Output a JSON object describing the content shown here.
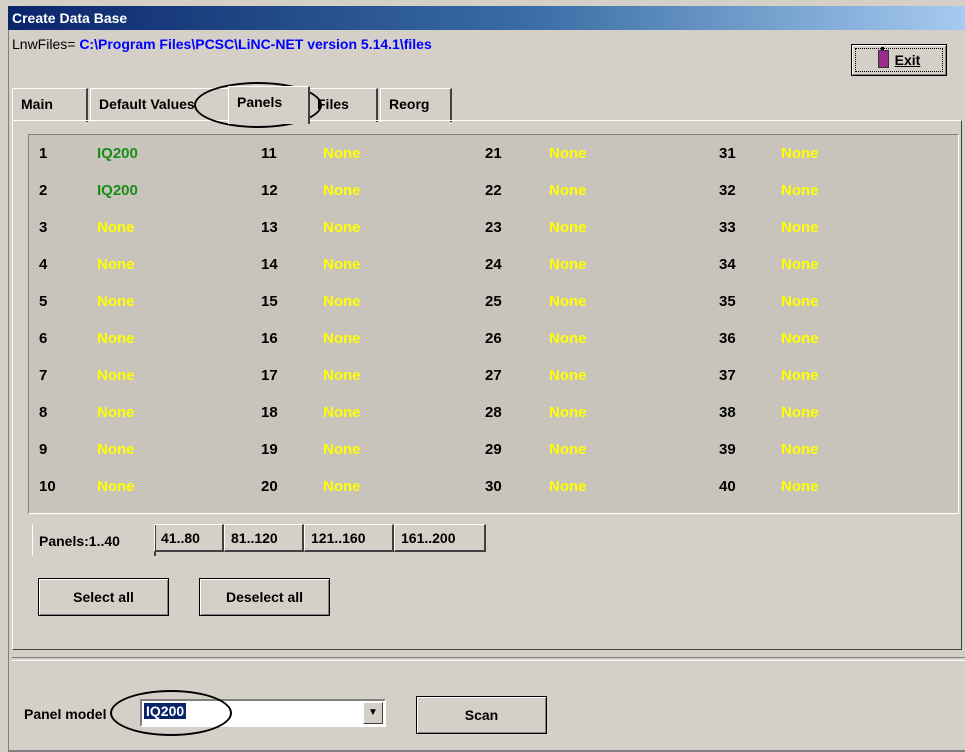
{
  "window": {
    "title": "Create Data Base"
  },
  "path": {
    "label": "LnwFiles=",
    "value": "C:\\Program Files\\PCSC\\LiNC-NET version 5.14.1\\files"
  },
  "exit_label": "Exit",
  "tabs": [
    "Main",
    "Default Values",
    "Panels",
    "Files",
    "Reorg"
  ],
  "active_tab": "Panels",
  "panels": {
    "col1": [
      {
        "num": "1",
        "name": "IQ200"
      },
      {
        "num": "2",
        "name": "IQ200"
      },
      {
        "num": "3",
        "name": "None"
      },
      {
        "num": "4",
        "name": "None"
      },
      {
        "num": "5",
        "name": "None"
      },
      {
        "num": "6",
        "name": "None"
      },
      {
        "num": "7",
        "name": "None"
      },
      {
        "num": "8",
        "name": "None"
      },
      {
        "num": "9",
        "name": "None"
      },
      {
        "num": "10",
        "name": "None"
      }
    ],
    "col2": [
      {
        "num": "11",
        "name": "None"
      },
      {
        "num": "12",
        "name": "None"
      },
      {
        "num": "13",
        "name": "None"
      },
      {
        "num": "14",
        "name": "None"
      },
      {
        "num": "15",
        "name": "None"
      },
      {
        "num": "16",
        "name": "None"
      },
      {
        "num": "17",
        "name": "None"
      },
      {
        "num": "18",
        "name": "None"
      },
      {
        "num": "19",
        "name": "None"
      },
      {
        "num": "20",
        "name": "None"
      }
    ],
    "col3": [
      {
        "num": "21",
        "name": "None"
      },
      {
        "num": "22",
        "name": "None"
      },
      {
        "num": "23",
        "name": "None"
      },
      {
        "num": "24",
        "name": "None"
      },
      {
        "num": "25",
        "name": "None"
      },
      {
        "num": "26",
        "name": "None"
      },
      {
        "num": "27",
        "name": "None"
      },
      {
        "num": "28",
        "name": "None"
      },
      {
        "num": "29",
        "name": "None"
      },
      {
        "num": "30",
        "name": "None"
      }
    ],
    "col4": [
      {
        "num": "31",
        "name": "None"
      },
      {
        "num": "32",
        "name": "None"
      },
      {
        "num": "33",
        "name": "None"
      },
      {
        "num": "34",
        "name": "None"
      },
      {
        "num": "35",
        "name": "None"
      },
      {
        "num": "36",
        "name": "None"
      },
      {
        "num": "37",
        "name": "None"
      },
      {
        "num": "38",
        "name": "None"
      },
      {
        "num": "39",
        "name": "None"
      },
      {
        "num": "40",
        "name": "None"
      }
    ]
  },
  "page_tabs": [
    "Panels:1..40",
    "41..80",
    "81..120",
    "121..160",
    "161..200"
  ],
  "select_all_label": "Select all",
  "deselect_all_label": "Deselect all",
  "panel_model": {
    "label": "Panel model",
    "value": "IQ200"
  },
  "scan_label": "Scan",
  "colors": {
    "assigned": "#1a8c1a",
    "unassigned": "#ffff00",
    "path": "#0000ff",
    "titlebar": "#0a246a"
  }
}
